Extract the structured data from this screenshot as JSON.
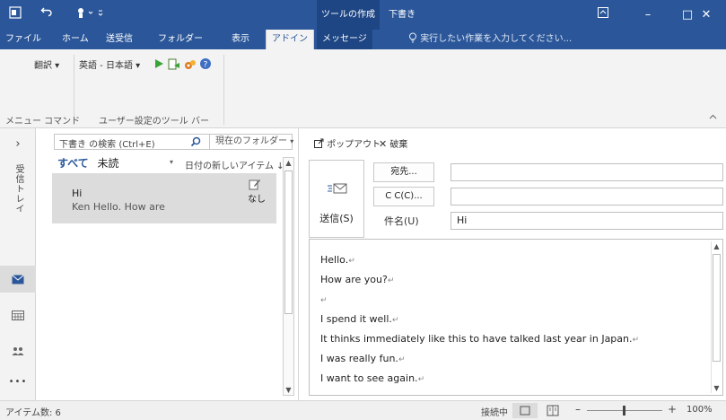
{
  "titlebar": {
    "contextual_tab_group": "ツールの作成",
    "document_title": "下書き",
    "restore_icon": "ribbon-display-options-icon",
    "minimize_glyph": "–",
    "maximize_glyph": "□",
    "close_glyph": "✕"
  },
  "tabs": {
    "file": "ファイル",
    "home": "ホーム",
    "send_receive": "送受信",
    "folder": "フォルダー",
    "view": "表示",
    "addins": "アドイン",
    "message": "メッセージ",
    "tell_me": "実行したい作業を入力してください..."
  },
  "ribbon": {
    "translate": "翻訳 ▾",
    "language_pair": "英語 - 日本語 ▾",
    "group_menu_commands": "メニュー コマンド",
    "group_custom_toolbars": "ユーザー設定のツール バー"
  },
  "rail": {
    "expand": "›",
    "folder_name": "受信トレイ",
    "more": "•••"
  },
  "list": {
    "search_placeholder": "下書き の検索 (Ctrl+E)",
    "scope": "現在のフォルダー",
    "filter_all": "すべて",
    "filter_unread": "未読",
    "sort_label": "日付の新しいアイテム ↓",
    "items": [
      {
        "from": "Hi",
        "preview": "Ken  Hello.  How are",
        "category": "なし"
      }
    ]
  },
  "compose": {
    "popout": "ポップアウト",
    "discard": "破棄",
    "send": "送信(S)",
    "to_button": "宛先...",
    "cc_button": "C C(C)...",
    "subject_label": "件名(U)",
    "to_value": "",
    "cc_value": "",
    "subject_value": "Hi",
    "body_lines": [
      "Hello.",
      "How are you?",
      "",
      "I spend it well.",
      "It thinks immediately like this to have talked last year in Japan.",
      "I was really fun.",
      "I want to see again."
    ],
    "paragraph_mark": "↵"
  },
  "status": {
    "item_count": "アイテム数: 6",
    "connection": "接続中",
    "zoom": "100%"
  },
  "colors": {
    "accent": "#2b579a",
    "accent_dark": "#1e4684",
    "ribbon_bg": "#f3f3f3",
    "selection": "#dcdcdc"
  }
}
